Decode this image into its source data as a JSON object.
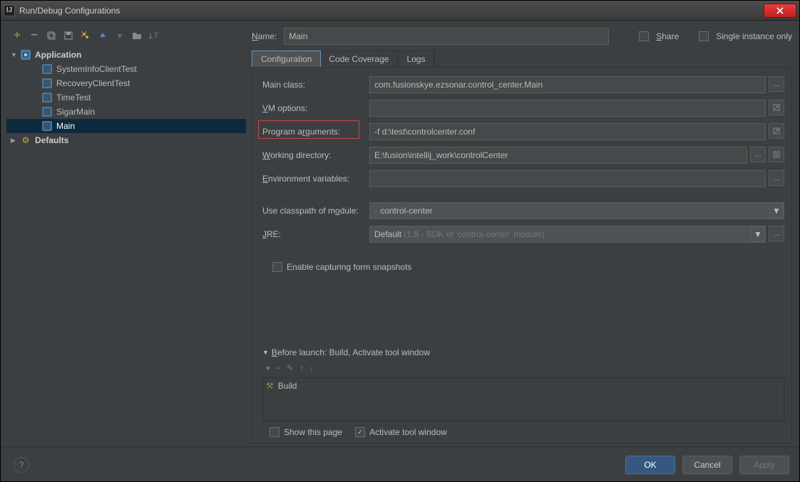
{
  "window": {
    "title": "Run/Debug Configurations"
  },
  "tree": {
    "application_label": "Application",
    "items": [
      "SystemInfoClientTest",
      "RecoveryClientTest",
      "TimeTest",
      "SigarMain",
      "Main"
    ],
    "selected_index": 4,
    "defaults_label": "Defaults"
  },
  "name": {
    "label_pre": "N",
    "label_post": "ame:",
    "value": "Main"
  },
  "share_label": "Share",
  "single_instance_label": "Single instance only",
  "tabs": {
    "config": "Configuration",
    "coverage": "Code Coverage",
    "logs": "Logs"
  },
  "form": {
    "main_class": {
      "label": "Main class:",
      "value": "com.fusionskye.ezsonar.control_center.Main"
    },
    "vm_options": {
      "label_pre": "V",
      "label_post": "M options:",
      "value": ""
    },
    "program_args": {
      "label_pre": "Program a",
      "label_u": "r",
      "label_post": "guments:",
      "value": "-f d:\\test\\controlcenter.conf"
    },
    "working_dir": {
      "label_pre": "W",
      "label_post": "orking directory:",
      "value": "E:\\fusion\\intellij_work\\controlCenter"
    },
    "env_vars": {
      "label_pre": "E",
      "label_post": "nvironment variables:",
      "value": ""
    },
    "module": {
      "label_pre": "Use classpath of m",
      "label_u": "o",
      "label_post": "dule:",
      "value": "control-center"
    },
    "jre": {
      "label_pre": "J",
      "label_post": "RE:",
      "value": "Default",
      "hint": " (1.8 - SDK of 'control-center' module)"
    },
    "snapshots": "Enable capturing form snapshots"
  },
  "before_launch": {
    "header_pre": "B",
    "header_post": "efore launch: Build, Activate tool window",
    "item": "Build",
    "show_page": "Show this page",
    "activate": "Activate tool window"
  },
  "buttons": {
    "ok": "OK",
    "cancel": "Cancel",
    "apply": "Apply"
  }
}
